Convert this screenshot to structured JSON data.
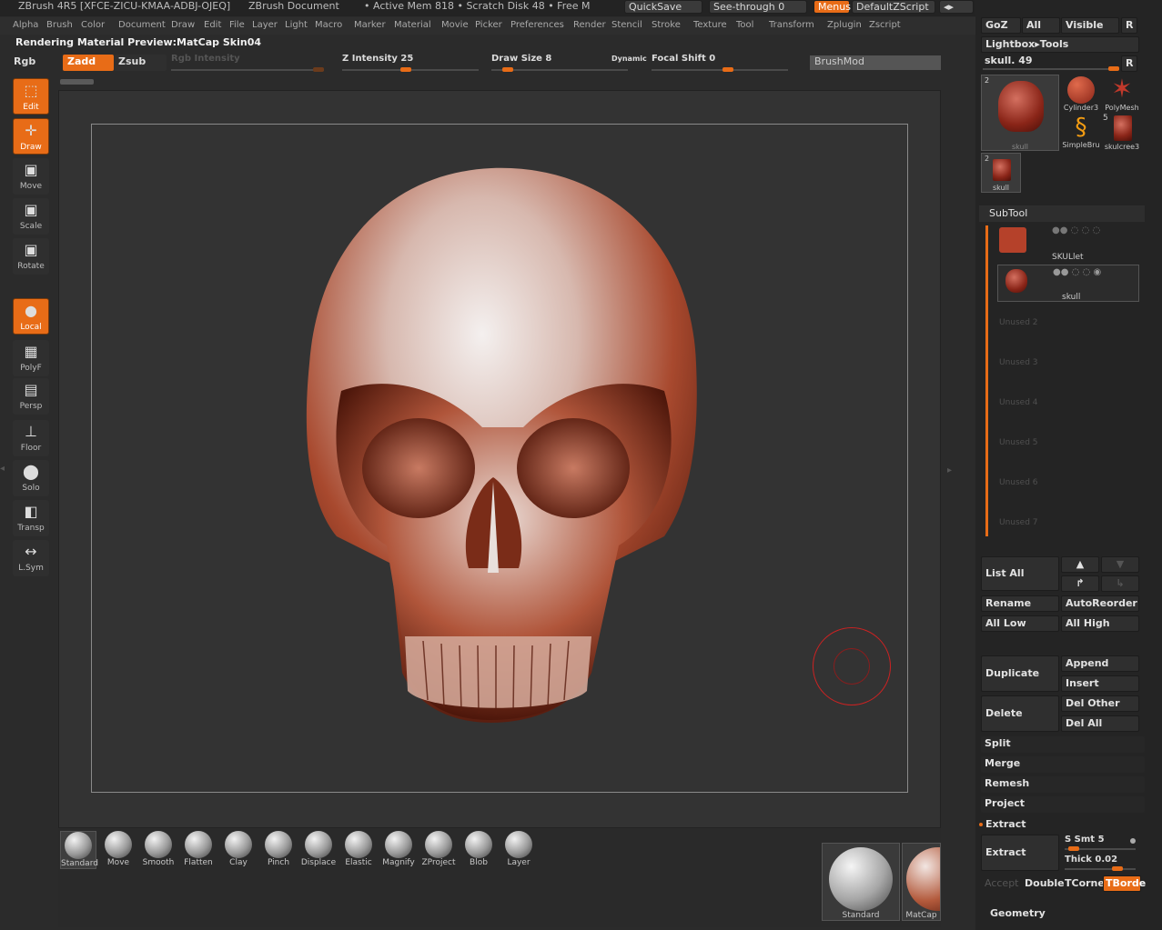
{
  "titlebar": {
    "app": "ZBrush 4R5 [XFCE-ZICU-KMAA-ADBJ-OJEQ]",
    "document": "ZBrush Document",
    "mem": "• Active Mem 818 • Scratch Disk 48 • Free M",
    "quicksave": "QuickSave",
    "seethrough": "See-through  0",
    "menus": "Menus",
    "script": "DefaultZScript"
  },
  "menu": [
    "Alpha",
    "Brush",
    "Color",
    "Document",
    "Draw",
    "Edit",
    "File",
    "Layer",
    "Light",
    "Macro",
    "Marker",
    "Material",
    "Movie",
    "Picker",
    "Preferences",
    "Render",
    "Stencil",
    "Stroke",
    "Texture",
    "Tool",
    "Transform",
    "Zplugin",
    "Zscript"
  ],
  "info": "Rendering Material Preview:MatCap Skin04",
  "toprow": {
    "rgb": "Rgb",
    "zadd": "Zadd",
    "zsub": "Zsub",
    "rgb_intensity": "Rgb Intensity",
    "z_intensity": "Z Intensity 25",
    "draw_size": "Draw Size 8",
    "dynamic": "Dynamic",
    "focal_shift": "Focal Shift 0",
    "brushmod": "BrushMod"
  },
  "lefttools": [
    "Edit",
    "Draw",
    "Move",
    "Scale",
    "Rotate",
    "Local",
    "PolyF",
    "Persp",
    "Floor",
    "Solo",
    "Transp",
    "L.Sym"
  ],
  "brushes": [
    "Standard",
    "Move",
    "Smooth",
    "Flatten",
    "Clay",
    "Pinch",
    "Displace",
    "Elastic",
    "Magnify",
    "ZProject",
    "Blob",
    "Layer"
  ],
  "shelf_right": {
    "standard": "Standard",
    "matcap": "MatCap"
  },
  "right": {
    "goz": "GoZ",
    "all": "All",
    "visible": "Visible",
    "r": "R",
    "lightbox": "Lightbox▸Tools",
    "tool_name": "skull. 49",
    "tools": [
      {
        "label": "skull",
        "count": "2"
      },
      {
        "label": "Cylinder3"
      },
      {
        "label": "PolyMesh"
      },
      {
        "label": "SimpleBru"
      },
      {
        "label": "skulcree3",
        "count": "5"
      },
      {
        "label": "skull",
        "count": "2"
      }
    ],
    "subtool_header": "SubTool",
    "subtools": [
      "SKULlet",
      "skull"
    ],
    "unused": [
      "Unused 2",
      "Unused 3",
      "Unused 4",
      "Unused 5",
      "Unused 6",
      "Unused 7"
    ],
    "list_all": "List All",
    "rename": "Rename",
    "autoreorder": "AutoReorder",
    "all_low": "All Low",
    "all_high": "All High",
    "duplicate": "Duplicate",
    "append": "Append",
    "insert": "Insert",
    "delete": "Delete",
    "del_other": "Del Other",
    "del_all": "Del All",
    "split": "Split",
    "merge": "Merge",
    "remesh": "Remesh",
    "project": "Project",
    "extract_header": "Extract",
    "extract_btn": "Extract",
    "smt": "S Smt 5",
    "thick": "Thick 0.02",
    "accept": "Accept",
    "double": "Double",
    "tcorne": "TCorne",
    "tborde": "TBorde",
    "geometry": "Geometry"
  },
  "colors": {
    "accent": "#e86c17",
    "skull": "#a8492e"
  }
}
